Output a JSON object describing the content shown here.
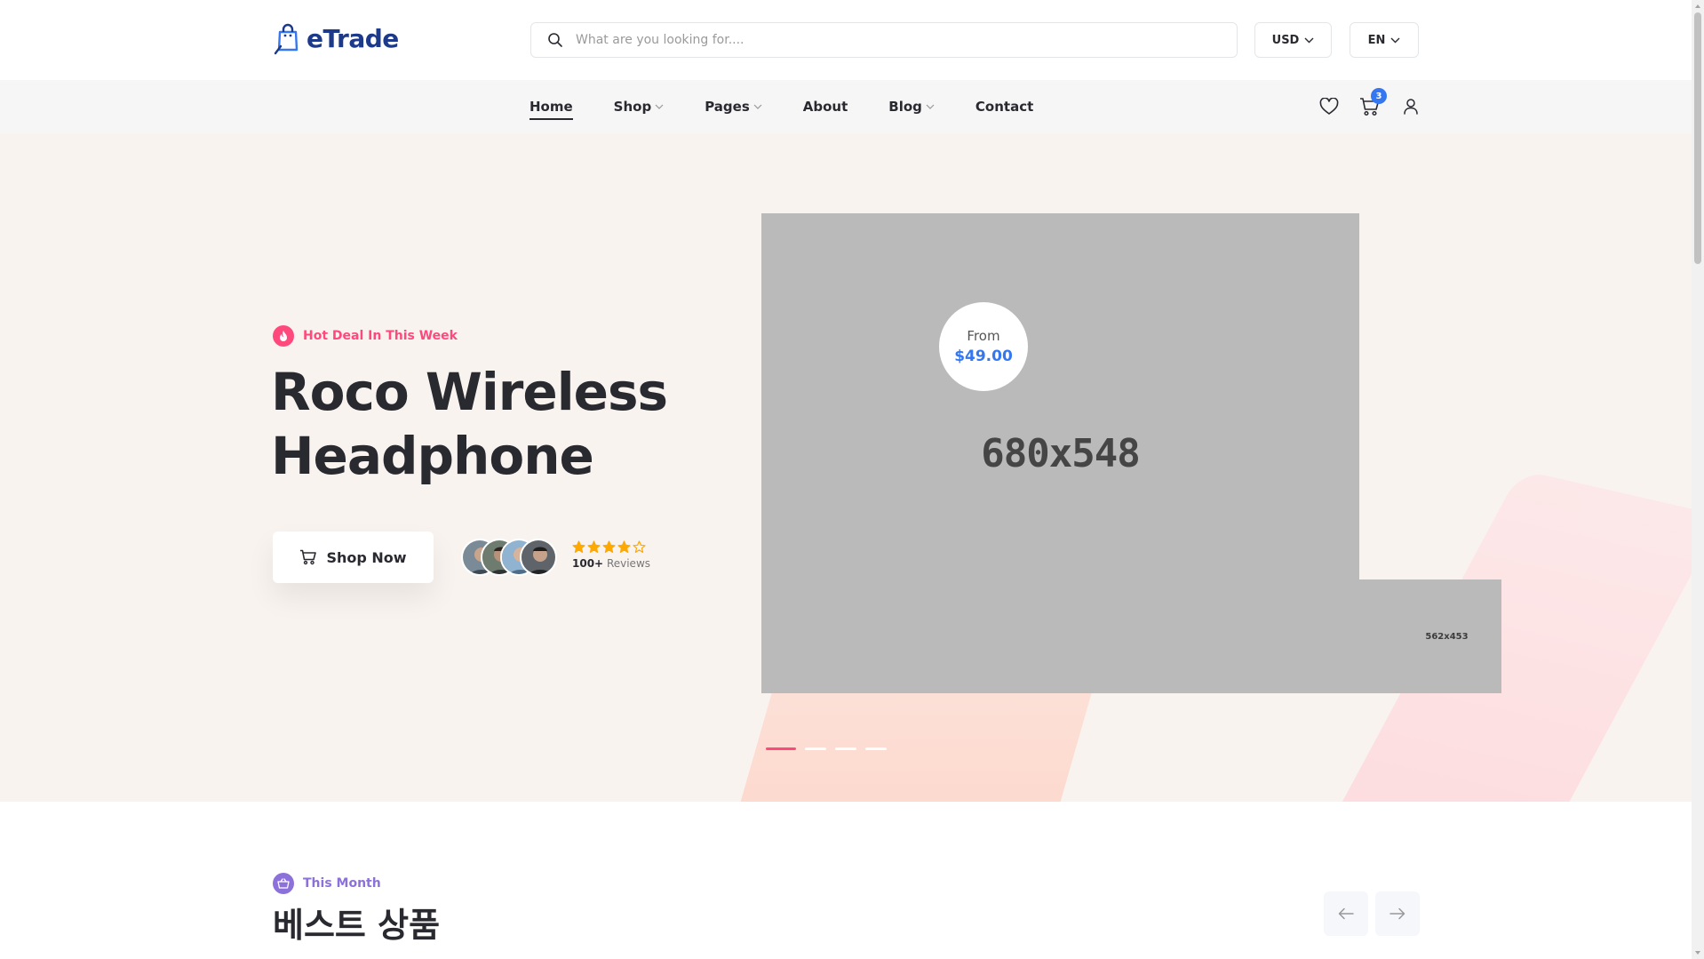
{
  "header": {
    "logo_text": "eTrade",
    "search_placeholder": "What are you looking for....",
    "currency": "USD",
    "language": "EN"
  },
  "nav": {
    "items": [
      {
        "label": "Home",
        "active": true,
        "dropdown": false
      },
      {
        "label": "Shop",
        "active": false,
        "dropdown": true
      },
      {
        "label": "Pages",
        "active": false,
        "dropdown": true
      },
      {
        "label": "About",
        "active": false,
        "dropdown": false
      },
      {
        "label": "Blog",
        "active": false,
        "dropdown": true
      },
      {
        "label": "Contact",
        "active": false,
        "dropdown": false
      }
    ],
    "cart_count": "3",
    "icons": [
      "heart-icon",
      "cart-icon",
      "user-icon"
    ]
  },
  "hero": {
    "tag": "Hot Deal In This Week",
    "title": "Roco Wireless Headphone",
    "button_label": "Shop Now",
    "rating": 4,
    "reviews_count": "100+",
    "reviews_label": "Reviews",
    "main_image_label": "680x548",
    "back_image_label": "562x453",
    "price_from": "From",
    "price_value": "$49.00",
    "slides_total": 4,
    "slide_active": 1
  },
  "section": {
    "tag": "This Month",
    "title": "베스트 상품"
  },
  "colors": {
    "accent_blue": "#3577f0",
    "accent_pink": "#ff497c",
    "accent_purple": "#8c71db",
    "text_dark": "#292930",
    "hero_bg": "#f9f3f0"
  }
}
